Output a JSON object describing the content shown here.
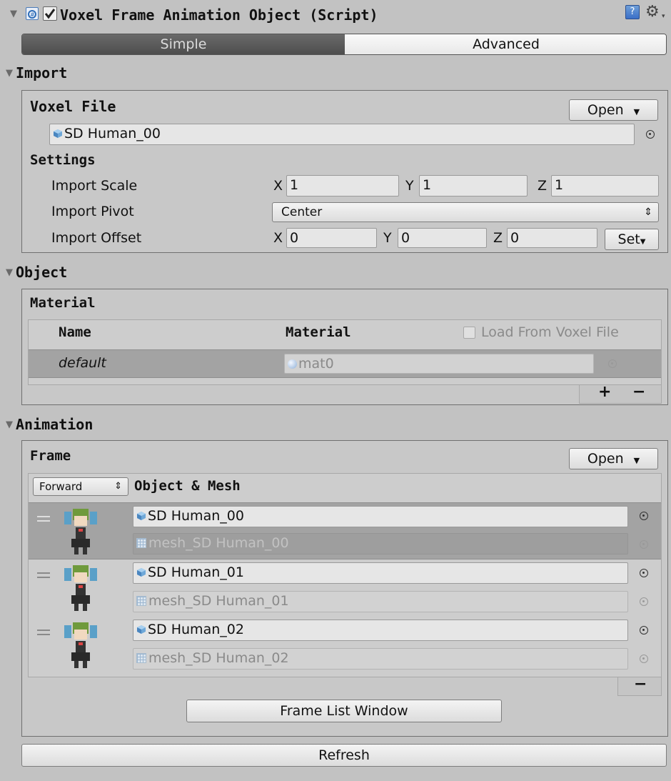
{
  "component": {
    "title": "Voxel Frame Animation Object (Script)",
    "enabled": true
  },
  "tabs": [
    {
      "label": "Simple",
      "active": true
    },
    {
      "label": "Advanced",
      "active": false
    }
  ],
  "import": {
    "section_label": "Import",
    "voxel_file_label": "Voxel File",
    "open_label": "Open",
    "voxel_file_value": "SD Human_00",
    "settings_label": "Settings",
    "scale": {
      "label": "Import Scale",
      "x_label": "X",
      "x": "1",
      "y_label": "Y",
      "y": "1",
      "z_label": "Z",
      "z": "1"
    },
    "pivot": {
      "label": "Import Pivot",
      "value": "Center"
    },
    "offset": {
      "label": "Import Offset",
      "x_label": "X",
      "x": "0",
      "y_label": "Y",
      "y": "0",
      "z_label": "Z",
      "z": "0",
      "set_label": "Set"
    }
  },
  "object": {
    "section_label": "Object",
    "material_label": "Material",
    "columns": {
      "name": "Name",
      "material": "Material",
      "load_from_voxel": "Load From Voxel File"
    },
    "load_from_voxel_checked": false,
    "rows": [
      {
        "name": "default",
        "material": "mat0"
      }
    ],
    "add_label": "+",
    "remove_label": "−"
  },
  "animation": {
    "section_label": "Animation",
    "frame_label": "Frame",
    "open_label": "Open",
    "direction": "Forward",
    "object_mesh_label": "Object & Mesh",
    "frames": [
      {
        "object": "SD Human_00",
        "mesh": "mesh_SD Human_00",
        "selected": true
      },
      {
        "object": "SD Human_01",
        "mesh": "mesh_SD Human_01",
        "selected": false
      },
      {
        "object": "SD Human_02",
        "mesh": "mesh_SD Human_02",
        "selected": false
      }
    ],
    "remove_label": "−",
    "frame_list_window_label": "Frame List Window"
  },
  "refresh_label": "Refresh",
  "colors": {
    "background": "#c2c2c2",
    "selected_row": "#a3a3a3",
    "tab_active": "#5c5c5c",
    "check_blue": "#3a6fc8"
  },
  "icons": [
    "foldout-arrow-icon",
    "script-icon",
    "help-icon",
    "gear-icon",
    "cube-icon",
    "object-picker-icon",
    "mesh-icon",
    "material-sphere-icon",
    "drag-handle-icon",
    "voxel-character-thumbnail"
  ]
}
